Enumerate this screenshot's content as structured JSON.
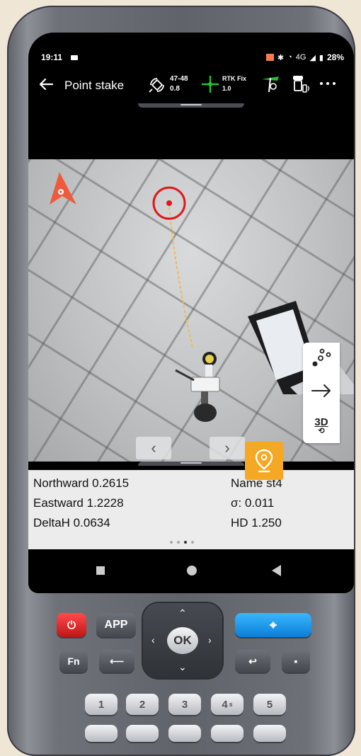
{
  "status_bar": {
    "time": "19:11",
    "network": "4G",
    "battery": "28%"
  },
  "app_bar": {
    "title": "Point stake",
    "satellites": "47-48",
    "pdop": "0.8",
    "fix_status": "RTK Fix",
    "fix_age": "1.0"
  },
  "side_tools": {
    "view_3d_label": "3D"
  },
  "info_panel": {
    "northward": "Northward 0.2615",
    "eastward": "Eastward 1.2228",
    "delta_h": "DeltaH 0.0634",
    "name": "Name st4",
    "sigma": "σ: 0.011",
    "hd": "HD 1.250",
    "pages": 4,
    "active_page": 3
  },
  "keypad": {
    "app_label": "APP",
    "fn_label": "Fn",
    "ok_label": "OK",
    "num_keys": [
      "1",
      "2",
      "3",
      "4",
      "5"
    ],
    "num_subs": [
      "",
      "",
      "",
      "s",
      ""
    ]
  },
  "colors": {
    "accent_orange": "#f4a823",
    "target_red": "#e01818",
    "fix_green": "#22c22a"
  }
}
